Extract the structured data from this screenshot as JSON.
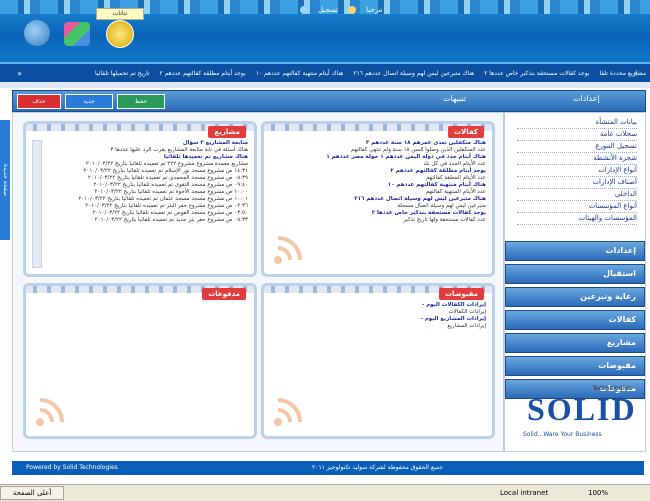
{
  "header": {
    "welcome_text": "مرحبا",
    "login_text": "تسجيل",
    "badge_label": "تنانات"
  },
  "ticker": {
    "items": [
      "تاريخ تم تحميلها تلقائيا",
      "يوجد أيتام مطلقة كفالتهم عددهم ٢",
      "هناك أيتام منتهية كفالتهم عددهم ١٠",
      "هناك متبرعين ليس لهم وسيلة اتصال عددهم ٢١٦",
      "يوجد كفالات مستحقة بتذكير خاص عددها ٢",
      "مشاريع محددة تلقا"
    ]
  },
  "toolbar": {
    "delete_label": "حذف",
    "new_label": "جديد",
    "save_label": "حفظ",
    "alerts_label": "تنبيهات",
    "settings_label": "إعدادات"
  },
  "left_tab": {
    "label": "صفحة جديدة"
  },
  "panels": {
    "kafalat": {
      "title": "كفالات",
      "lines": [
        {
          "t": "hd",
          "v": "هناك متكفلين تعدى عمرهم ١٨ سنة عددهم ٣"
        },
        {
          "t": "tx",
          "v": "عدد المتكفلين الذين وصلوا السن ١٨ سنة ولم تنتهي كفالتهم"
        },
        {
          "t": "hd",
          "v": "هناك أيتام جدد في دولة اليمن عددهم ١ حولة مصر عددهم ١"
        },
        {
          "t": "tx",
          "v": "عدد الأيتام الجدد في كل بلد"
        },
        {
          "t": "hd",
          "v": "يوجد أيتام مطلقة كفالتهم عددهم ٢"
        },
        {
          "t": "tx",
          "v": "عدد الأيتام المعلقة كفالتهم"
        },
        {
          "t": "hd",
          "v": "هناك أيتام منتهية كفالتهم عددهم ١٠"
        },
        {
          "t": "tx",
          "v": "عدد الأيتام المنتهية كفالتهم"
        },
        {
          "t": "hd",
          "v": "هناك متبرعين ليس لهم وسيلة اتصال عددهم ٢١٦"
        },
        {
          "t": "tx",
          "v": "متبرعين ليس لهم وسيلة اتصال مسجلة"
        },
        {
          "t": "hd",
          "v": "يوجد كفالات مستحقة بتذكير خاص عددها ٢"
        },
        {
          "t": "tx",
          "v": "عدد كفالات مستحقة ولها تاريخ تذكير"
        }
      ]
    },
    "mashari": {
      "title": "مشاريع",
      "lines": [
        {
          "t": "hd",
          "v": "متابعة المشاريع ٣ سؤال"
        },
        {
          "t": "tx",
          "v": "هناك أسئلة في تابة متابعة المشاريع يقرب الرد عليها عددها ٣"
        },
        {
          "t": "hd",
          "v": "هناك مشاريع تم تعميدها تلقائيا"
        },
        {
          "t": "tx",
          "v": "مشاريع معمدة مشروع مشروع ٢٢٢ تم تعميده تلقائيا بتاريخ ٢٠١٠/٠٣/٢٢"
        },
        {
          "t": "tx",
          "v": "١٤:٣١ ص مشروع مسجد نور الإسلام تم تعميده تلقائيا بتاريخ ٢٠١٠/٠٣/٢٢"
        },
        {
          "t": "tx",
          "v": "٠٥:٣٩ ص مشروع مسجد المحمدي تم تعميده تلقائيا بتاريخ ٢٠١٠/٠٣/٢٢"
        },
        {
          "t": "tx",
          "v": "٠٩:٤٠ ص مشروع مسجد التقوى تم تعميده تلقائيا بتاريخ ٢٠١٠/٠٣/٢٢"
        },
        {
          "t": "tx",
          "v": "١٠:٠٠ ص مشروع مسجد الأخوة تم تعميده تلقائيا بتاريخ ٢٠١٠/٠٣/٢٢"
        },
        {
          "t": "tx",
          "v": "١٠:٠١ ص مشروع مسجد مسجد عثمان تم تعميده تلقائيا بتاريخ ٢٠١٠/٠٣/٢٢"
        },
        {
          "t": "tx",
          "v": "٠٢:٣٦ ص مشروع مشروع حفر البئر تم تعميده تلقائيا بتاريخ ٢٠١٠/٠٣/٢٢"
        },
        {
          "t": "tx",
          "v": "٠٣:٥٠ ص مشروع مسجد القوس تم تعميده تلقائيا بتاريخ ٢٠١٠/٠٣/٢٢"
        },
        {
          "t": "tx",
          "v": "٠٥:٣٣ ص مشروع حفر بئر جديد تم تعميده تلقائيا بتاريخ ٢٠١٠/٠٣/٢٢"
        }
      ]
    },
    "maqbudat": {
      "title": "مقبوضات",
      "lines": [
        {
          "t": "hd",
          "v": "إيرادات الكفالات اليوم -"
        },
        {
          "t": "tx",
          "v": "إيرادات الكفالات"
        },
        {
          "t": "hd",
          "v": "إيرادات المشاريع اليوم -"
        },
        {
          "t": "tx",
          "v": "إيرادات المشاريع"
        }
      ]
    },
    "madfuat": {
      "title": "مدفوعات",
      "lines": []
    }
  },
  "sidebar": {
    "links": [
      "بيانات المنشأة",
      "سجلات عامة",
      "تسجيل المورع",
      "شجرة الأنشطة",
      "أنواع الإدارات",
      "أصناف الإدارات",
      "الداخلي",
      "أنواع المؤسسات",
      "المؤسسات والهيئات"
    ],
    "nav": [
      "إعدادات",
      "استقبال",
      "رعاية وتبرعين",
      "كفالات",
      "مشاريع",
      "مقبوضات",
      "مدفوعات"
    ]
  },
  "brand": {
    "tech": "Technologies",
    "word": "SOLID",
    "tagline": "Solid...Ware  Your  Business"
  },
  "footer": {
    "left": "Powered by Solid Technologies",
    "right": "جميع الحقوق محفوظة لشركة سوليد تكنولوجيز ٢٠١١"
  },
  "statusbar": {
    "zone": "Local intranet",
    "zoom": "100%",
    "tab_label": "أعلى الصفحة"
  }
}
